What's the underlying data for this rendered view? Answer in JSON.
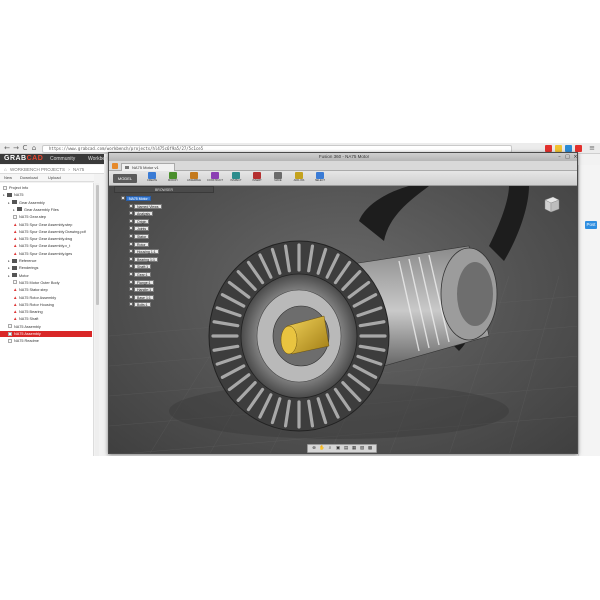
{
  "browser": {
    "url": "https://www.grabcad.com/workbench/projects/hl475c6f9a5/27/5c1ce5",
    "nav_back": "←",
    "nav_forward": "→",
    "nav_reload": "C",
    "nav_home": "⌂",
    "ext_colors": [
      "#e3312d",
      "#f1c232",
      "#2b8bd6",
      "#e3312d"
    ]
  },
  "grabcad": {
    "logo_primary": "GRAB",
    "logo_accent": "CAD",
    "nav": [
      "Community",
      "Workbench"
    ],
    "breadcrumb_root": "WORKBENCH PROJECTS",
    "breadcrumb_current": "NA75",
    "tabs": [
      "New",
      "Download",
      "Upload"
    ],
    "right_button": "Post",
    "brand_red": "#d92727"
  },
  "tree": [
    {
      "depth": 0,
      "kind": "row",
      "label": "Project Info"
    },
    {
      "depth": 0,
      "kind": "folder",
      "label": "NA75"
    },
    {
      "depth": 1,
      "kind": "folder",
      "label": "Gear Assembly"
    },
    {
      "depth": 2,
      "kind": "folder",
      "label": "Gear Assembly Files"
    },
    {
      "depth": 2,
      "kind": "doc",
      "label": "NA75 Gear.step"
    },
    {
      "depth": 2,
      "kind": "warn",
      "label": "NA75 Spur Gear Assembly.step"
    },
    {
      "depth": 2,
      "kind": "warn",
      "label": "NA75 Spur Gear Assembly Drawing.pdf"
    },
    {
      "depth": 2,
      "kind": "warn",
      "label": "NA75 Spur Gear Assembly.dwg"
    },
    {
      "depth": 2,
      "kind": "warn",
      "label": "NA75 Spur Gear Assembly.x_t"
    },
    {
      "depth": 2,
      "kind": "warn",
      "label": "NA75 Spur Gear Assembly.iges"
    },
    {
      "depth": 1,
      "kind": "folder",
      "label": "Reference"
    },
    {
      "depth": 1,
      "kind": "folder",
      "label": "Renderings"
    },
    {
      "depth": 1,
      "kind": "folder",
      "label": "Motor"
    },
    {
      "depth": 2,
      "kind": "doc",
      "label": "NA75 Motor Outer Body"
    },
    {
      "depth": 2,
      "kind": "warn",
      "label": "NA75 Stator.step"
    },
    {
      "depth": 2,
      "kind": "warn",
      "label": "NA75 Rotor Assembly"
    },
    {
      "depth": 2,
      "kind": "warn",
      "label": "NA75 Rotor Housing"
    },
    {
      "depth": 2,
      "kind": "warn",
      "label": "NA75 Bearing"
    },
    {
      "depth": 2,
      "kind": "warn",
      "label": "NA75 Shaft"
    },
    {
      "depth": 1,
      "kind": "doc",
      "label": "NA75 Assembly"
    },
    {
      "depth": 1,
      "kind": "doc",
      "label": "NA75 Assembly",
      "selected": true
    },
    {
      "depth": 1,
      "kind": "doc",
      "label": "NA75 Readme"
    }
  ],
  "app": {
    "window_title": "Fusion 360 - NA75 Motor",
    "doc_tab": "NA75 Motor v1",
    "model_button": "MODEL",
    "ribbon": [
      {
        "label": "CREATE",
        "color": "#3a7bd5"
      },
      {
        "label": "MODIFY",
        "color": "#4a8f2c"
      },
      {
        "label": "ASSEMBLE",
        "color": "#c47a1d"
      },
      {
        "label": "CONSTRUCT",
        "color": "#8b3fb3"
      },
      {
        "label": "INSPECT",
        "color": "#2c8c8c"
      },
      {
        "label": "INSERT",
        "color": "#b53030"
      },
      {
        "label": "MAKE",
        "color": "#6b6b6b"
      },
      {
        "label": "ADD-INS",
        "color": "#c4a21d"
      },
      {
        "label": "SELECT",
        "color": "#3a7bd5"
      }
    ],
    "browser_title": "BROWSER",
    "browser_items": [
      {
        "indent": 0,
        "label": "NA75 Motor",
        "root": true
      },
      {
        "indent": 1,
        "label": "Named Views"
      },
      {
        "indent": 1,
        "label": "Analysis"
      },
      {
        "indent": 1,
        "label": "Origin"
      },
      {
        "indent": 1,
        "label": "Joints"
      },
      {
        "indent": 1,
        "label": "Stator"
      },
      {
        "indent": 1,
        "label": "Rotor"
      },
      {
        "indent": 1,
        "label": "Housing 1:1"
      },
      {
        "indent": 1,
        "label": "Bearing 1:1"
      },
      {
        "indent": 1,
        "label": "Shaft:1"
      },
      {
        "indent": 1,
        "label": "Gear:1"
      },
      {
        "indent": 1,
        "label": "Flange:1"
      },
      {
        "indent": 1,
        "label": "Handle:1"
      },
      {
        "indent": 1,
        "label": "Base 1:1"
      },
      {
        "indent": 1,
        "label": "Bolts:1"
      }
    ],
    "bottom_tools": [
      "⊕",
      "✋",
      "⌕",
      "▣",
      "▤",
      "▦",
      "▧",
      "▩"
    ]
  }
}
